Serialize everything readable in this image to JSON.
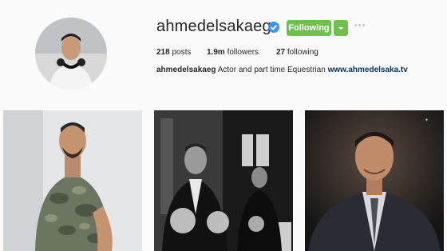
{
  "profile": {
    "username": "ahmedelsakaeg",
    "verified": true,
    "follow_label": "Following",
    "avatar_icon": "profile-photo"
  },
  "stats": {
    "posts_count": "218",
    "posts_label": "posts",
    "followers_count": "1.9m",
    "followers_label": "followers",
    "following_count": "27",
    "following_label": "following"
  },
  "bio": {
    "name": "ahmedelsakaeg",
    "text": "Actor and part time Equestrian",
    "link": "www.ahmedelsaka.tv"
  },
  "colors": {
    "follow_button": "#70c050",
    "verified_badge": "#3897f0",
    "link": "#003569"
  },
  "photos": [
    {
      "icon": "photo-man-camo-shirt"
    },
    {
      "icon": "photo-award-ceremony-bw"
    },
    {
      "icon": "photo-portrait-suit"
    }
  ]
}
